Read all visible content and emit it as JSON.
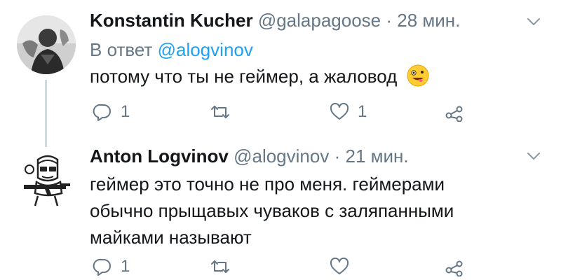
{
  "tweets": [
    {
      "author_name": "Konstantin Kucher",
      "handle": "@galapagoose",
      "separator": "·",
      "time": "28 мин.",
      "reply_prefix": "В ответ",
      "reply_mention": "@alogvinov",
      "text": "потому что ты не геймер, а жаловод",
      "emoji": "zany-face-emoji",
      "reply_count": "1",
      "retweet_count": "",
      "like_count": "1"
    },
    {
      "author_name": "Anton Logvinov",
      "handle": "@alogvinov",
      "separator": "·",
      "time": "21 мин.",
      "text": "геймер это точно не про меня. геймерами обычно прыщавых чуваков с заляпанными майками называют",
      "reply_count": "1",
      "retweet_count": "",
      "like_count": ""
    }
  ],
  "icons": {
    "reply": "reply-icon",
    "retweet": "retweet-icon",
    "like": "heart-icon",
    "share": "share-icon",
    "more": "chevron-down-icon"
  },
  "colors": {
    "text": "#14171a",
    "secondary": "#657786",
    "link": "#1da1f2",
    "thread_line": "#cfd9de"
  }
}
